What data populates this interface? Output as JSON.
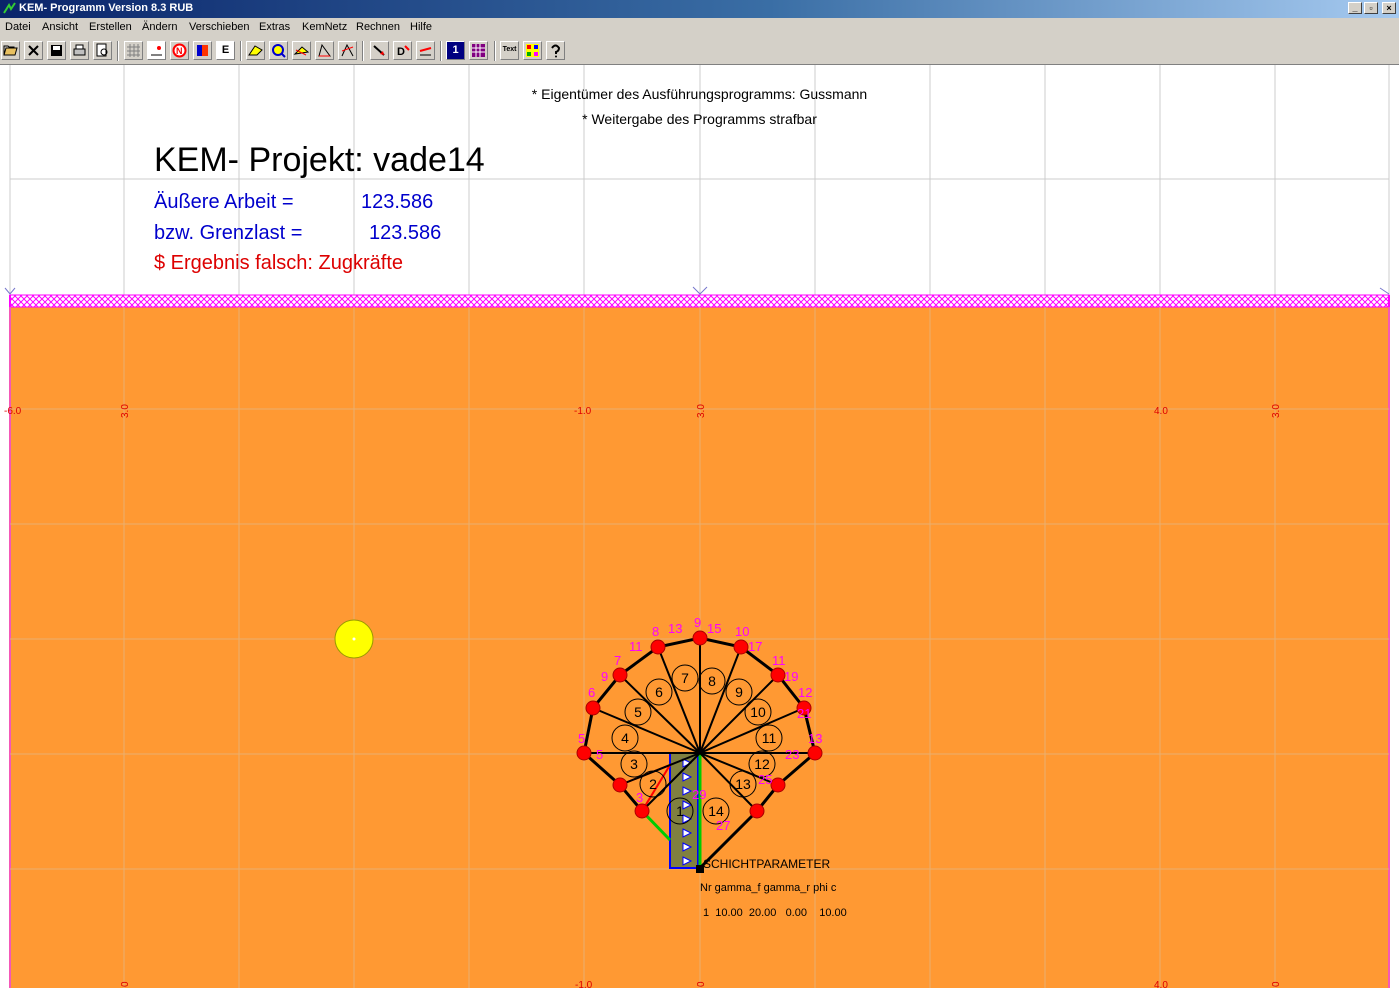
{
  "window": {
    "title": "KEM- Programm Version 8.3 RUB",
    "buttons": [
      "_",
      "▫",
      "×"
    ]
  },
  "menu": [
    "Datei",
    "Ansicht",
    "Erstellen",
    "Ändern",
    "Verschieben",
    "Extras",
    "KemNetz",
    "Rechnen",
    "Hilfe"
  ],
  "toolbar": {
    "icons": [
      "open-icon",
      "close-icon",
      "save-icon",
      "print-icon",
      "print-preview-icon",
      "grid-icon",
      "node-icon",
      "node-number-icon",
      "layer-icon",
      "e-icon",
      "polygon-icon",
      "zoom-icon",
      "move-icon",
      "angle-icon",
      "mirror-icon",
      "arrow-load-icon",
      "d-icon",
      "vector-icon",
      "number-1-icon",
      "matrix-icon",
      "text-icon",
      "color-icon",
      "help-icon"
    ],
    "e_label": "E",
    "one_label": "1",
    "text_label": "Text"
  },
  "header": {
    "owner": "* Eigentümer des Ausführungsprogramms: Gussmann",
    "notice": "* Weitergabe des Programms strafbar"
  },
  "project": {
    "title": "KEM- Projekt: vade14",
    "work_label": "Äußere Arbeit =",
    "work_value": "123.586",
    "limit_label": "bzw. Grenzlast =",
    "limit_value": "123.586",
    "error_text": "$ Ergebnis falsch: Zugkräfte"
  },
  "colors": {
    "soil": "#ff9933",
    "hatch": "#ff00ff",
    "node": "#ff0000",
    "node_label": "#ff00ff",
    "rigid_body": "#000000",
    "foundation": "#808040",
    "foundation_border": "#0000ff",
    "green_line": "#00cc00",
    "text_blue": "#0000cc",
    "text_red": "#dd0000",
    "grid": "#b0b0b0"
  },
  "axis_labels": {
    "left_row": [
      "-6.0",
      "3.0",
      "-1.0",
      "3.0",
      "4.0",
      "3.0"
    ],
    "bottom_row": [
      "0",
      "-1.0",
      "0",
      "4.0",
      "0"
    ]
  },
  "mechanism": {
    "outer_node_labels": [
      "5",
      "6",
      "7",
      "8",
      "9",
      "10",
      "11",
      "12",
      "13"
    ],
    "pink_labels": [
      "9",
      "11",
      "13",
      "15",
      "17",
      "19",
      "21",
      "23",
      "25",
      "27",
      "29",
      "3",
      "5"
    ],
    "body_numbers": [
      "1",
      "2",
      "3",
      "4",
      "5",
      "6",
      "7",
      "8",
      "9",
      "10",
      "11",
      "12",
      "13",
      "14"
    ]
  },
  "layer_table": {
    "heading": "SCHICHTPARAMETER",
    "columns": "Nr gamma_f gamma_r phi c",
    "row": "1  10.00  20.00   0.00    10.00"
  }
}
